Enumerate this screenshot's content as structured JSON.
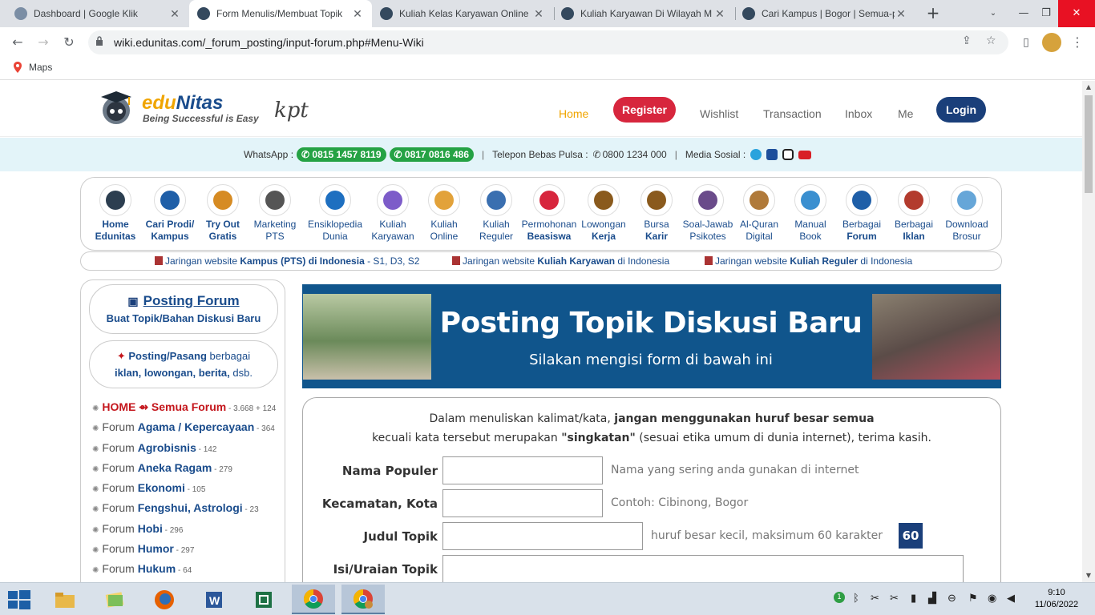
{
  "browser": {
    "tabs": [
      {
        "title": "Dashboard | Google Klik",
        "active": false
      },
      {
        "title": "Form Menulis/Membuat Topik",
        "active": true
      },
      {
        "title": "Kuliah Kelas Karyawan Online",
        "active": false
      },
      {
        "title": "Kuliah Karyawan Di Wilayah M",
        "active": false
      },
      {
        "title": "Cari Kampus | Bogor | Semua-p",
        "active": false
      }
    ],
    "url": "wiki.edunitas.com/_forum_posting/input-forum.php#Menu-Wiki",
    "bookmark": "Maps"
  },
  "header": {
    "brand_edu": "edu",
    "brand_nitas": "Nitas",
    "tagline": "Being Successful is Easy",
    "kpt_logo": "kpt",
    "nav": {
      "home": "Home",
      "register": "Register",
      "wishlist": "Wishlist",
      "transaction": "Transaction",
      "inbox": "Inbox",
      "me": "Me",
      "login": "Login"
    }
  },
  "contact": {
    "whatsapp_label": "WhatsApp :",
    "wa1": "0815 1457 8119",
    "wa2": "0817 0816 486",
    "tollfree_label": "Telepon Bebas Pulsa :",
    "tollfree": "0800 1234 000",
    "social_label": "Media Sosial :"
  },
  "icon_menu": [
    {
      "l1": "Home",
      "l2": "Edunitas",
      "bold": true
    },
    {
      "l1": "Cari Prodi/",
      "l2": "Kampus",
      "bold": true
    },
    {
      "l1": "Try Out",
      "l2": "Gratis",
      "bold": true
    },
    {
      "l1": "Marketing",
      "l2": "PTS",
      "bold": false
    },
    {
      "l1": "Ensiklopedia",
      "l2": "Dunia",
      "bold": false
    },
    {
      "l1": "Kuliah",
      "l2": "Karyawan",
      "bold": false
    },
    {
      "l1": "Kuliah",
      "l2": "Online",
      "bold": false
    },
    {
      "l1": "Kuliah",
      "l2": "Reguler",
      "bold": false
    },
    {
      "l1": "Permohonan",
      "l2": "Beasiswa",
      "bold": "l2"
    },
    {
      "l1": "Lowongan",
      "l2": "Kerja",
      "bold": "l2"
    },
    {
      "l1": "Bursa",
      "l2": "Karir",
      "bold": "l2"
    },
    {
      "l1": "Soal-Jawab",
      "l2": "Psikotes",
      "bold": false
    },
    {
      "l1": "Al-Quran",
      "l2": "Digital",
      "bold": false
    },
    {
      "l1": "Manual",
      "l2": "Book",
      "bold": false
    },
    {
      "l1": "Berbagai",
      "l2": "Forum",
      "bold": "l2"
    },
    {
      "l1": "Berbagai",
      "l2": "Iklan",
      "bold": "l2"
    },
    {
      "l1": "Download",
      "l2": "Brosur",
      "bold": false
    }
  ],
  "network": [
    {
      "pre": "Jaringan website ",
      "bold": "Kampus (PTS) di Indonesia",
      "post": " - S1, D3, S2"
    },
    {
      "pre": "Jaringan website ",
      "bold": "Kuliah Karyawan",
      "post": " di Indonesia"
    },
    {
      "pre": "Jaringan website ",
      "bold": "Kuliah Reguler",
      "post": " di Indonesia"
    }
  ],
  "sidebar": {
    "posting_title": "Posting Forum",
    "posting_sub": "Buat Topik/Bahan Diskusi Baru",
    "ads_bold": "Posting/Pasang",
    "ads_rest": " berbagai",
    "ads_line2": "iklan, lowongan, berita,",
    "ads_end": " dsb.",
    "home_item": {
      "home": "HOME",
      "arrow": "⇴",
      "label": "Semua Forum",
      "count": " - 3.668 + 124"
    },
    "forums": [
      {
        "prefix": "Forum ",
        "name": "Agama / Kepercayaan",
        "count": " - 364"
      },
      {
        "prefix": "Forum ",
        "name": "Agrobisnis",
        "count": " - 142"
      },
      {
        "prefix": "Forum ",
        "name": "Aneka Ragam",
        "count": " - 279"
      },
      {
        "prefix": "Forum ",
        "name": "Ekonomi",
        "count": " - 105"
      },
      {
        "prefix": "Forum ",
        "name": "Fengshui, Astrologi",
        "count": " - 23"
      },
      {
        "prefix": "Forum ",
        "name": "Hobi",
        "count": " - 296"
      },
      {
        "prefix": "Forum ",
        "name": "Humor",
        "count": " - 297"
      },
      {
        "prefix": "Forum ",
        "name": "Hukum",
        "count": " - 64"
      }
    ]
  },
  "banner": {
    "title": "Posting Topik Diskusi Baru",
    "subtitle": "Silakan mengisi form di bawah ini"
  },
  "form": {
    "intro1_pre": "Dalam menuliskan kalimat/kata, ",
    "intro1_bold": "jangan menggunakan huruf besar semua",
    "intro2_pre": "kecuali kata tersebut merupakan ",
    "intro2_bold": "\"singkatan\"",
    "intro2_post": " (sesuai etika umum di dunia internet), terima kasih.",
    "fields": [
      {
        "label": "Nama Populer",
        "hint": "Nama yang sering anda gunakan di internet",
        "value": ""
      },
      {
        "label": "Kecamatan, Kota",
        "hint": "Contoh: Cibinong, Bogor",
        "value": ""
      },
      {
        "label": "Judul Topik",
        "hint": "huruf besar kecil, maksimum 60 karakter",
        "value": ""
      },
      {
        "label": "Isi/Uraian Topik",
        "hint": "",
        "value": ""
      }
    ],
    "char_counter": "60"
  },
  "taskbar": {
    "time": "9:10",
    "date": "11/06/2022",
    "notif": "1"
  },
  "colors": {
    "brand_blue": "#1a4c8c",
    "brand_orange": "#f0a500",
    "register_red": "#d7263d",
    "whatsapp_green": "#25a244",
    "banner_blue": "#10558c"
  }
}
